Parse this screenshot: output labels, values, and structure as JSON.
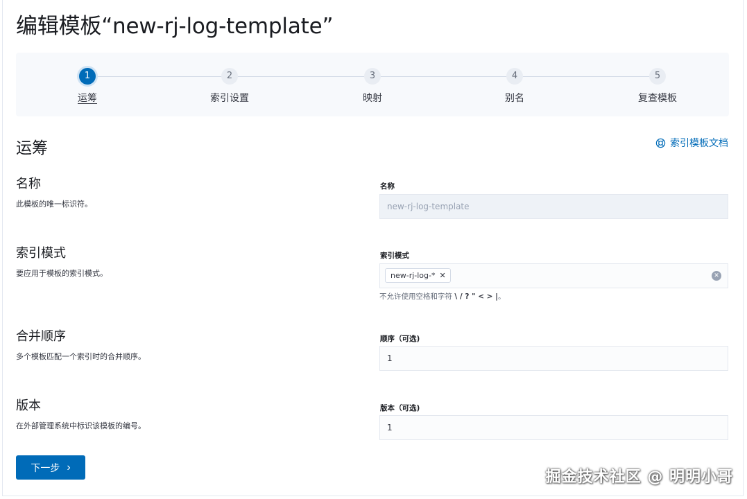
{
  "page_title": "编辑模板“new-rj-log-template”",
  "stepper": {
    "steps": [
      {
        "number": "1",
        "label": "运筹",
        "active": true
      },
      {
        "number": "2",
        "label": "索引设置",
        "active": false
      },
      {
        "number": "3",
        "label": "映射",
        "active": false
      },
      {
        "number": "4",
        "label": "别名",
        "active": false
      },
      {
        "number": "5",
        "label": "复查模板",
        "active": false
      }
    ]
  },
  "section": {
    "heading": "运筹",
    "doc_link_label": "索引模板文档",
    "doc_link_icon": "lifebuoy-icon",
    "accent_color": "#006bb8"
  },
  "fields": {
    "name": {
      "title": "名称",
      "description": "此模板的唯一标识符。",
      "label": "名称",
      "value": "new-rj-log-template",
      "disabled": true
    },
    "index_patterns": {
      "title": "索引模式",
      "description": "要应用于模板的索引模式。",
      "label": "索引模式",
      "pills": [
        "new-rj-log-*"
      ],
      "help_prefix": "不允许使用空格和字符",
      "help_chars": "\\ / ? \" < > |",
      "help_suffix": "。"
    },
    "order": {
      "title": "合并顺序",
      "description": "多个模板匹配一个索引时的合并顺序。",
      "label": "顺序（可选)",
      "value": "1"
    },
    "version": {
      "title": "版本",
      "description": "在外部管理系统中标识该模板的编号。",
      "label": "版本（可选)",
      "value": "1"
    }
  },
  "next_button": {
    "label": "下一步",
    "icon": "chevron-right-icon"
  },
  "watermark": "掘金技术社区 @ 明明小哥"
}
